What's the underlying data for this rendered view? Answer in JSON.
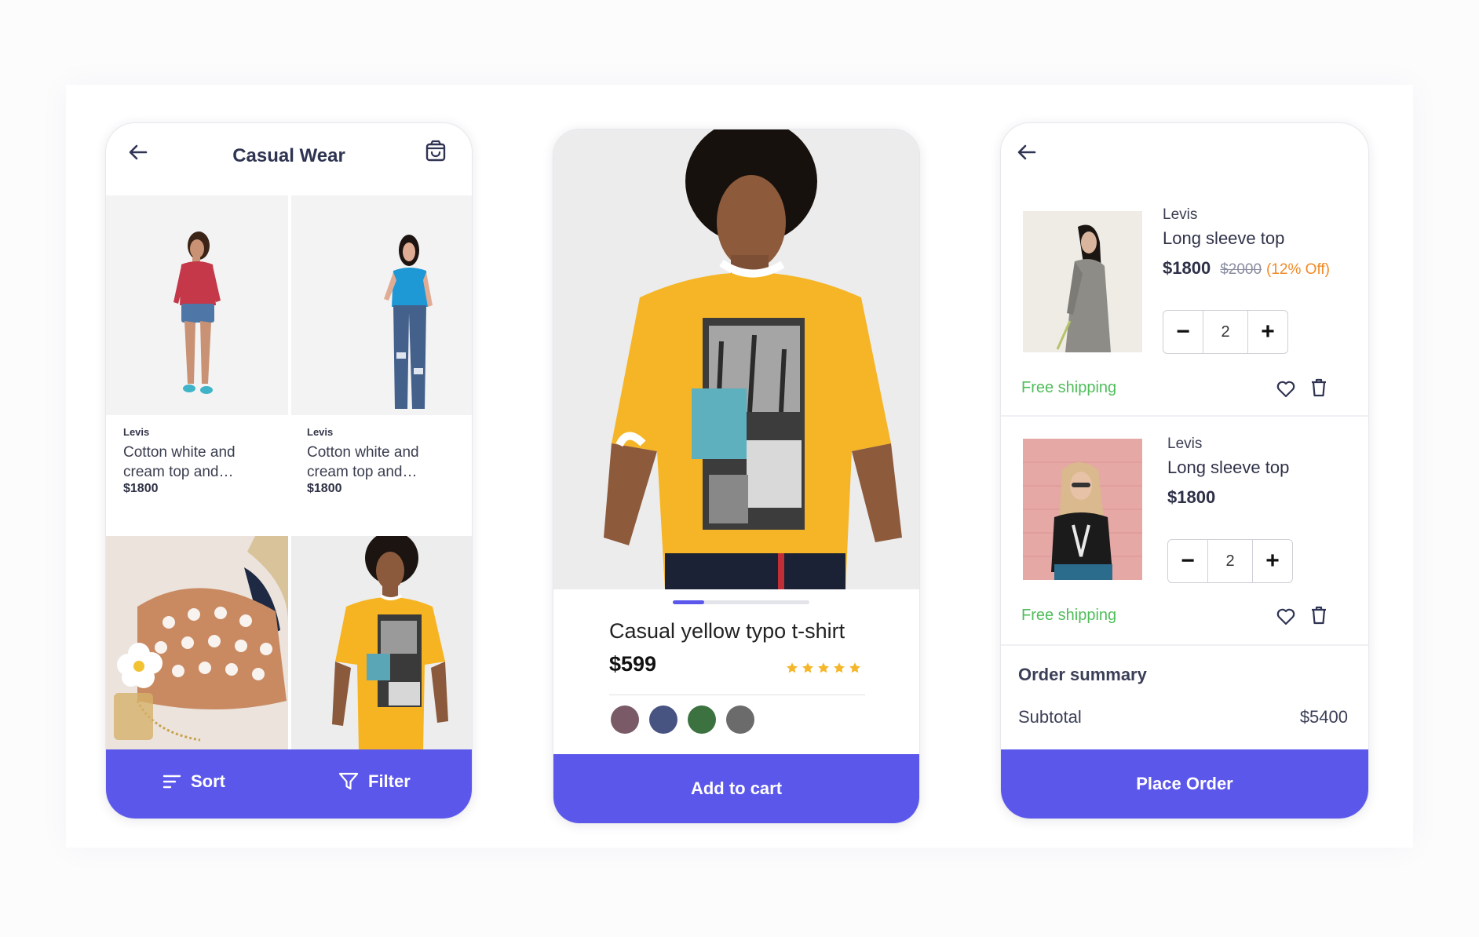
{
  "colors": {
    "accent": "#5b57eb",
    "shipping_green": "#4fbd5a",
    "discount_orange": "#f28a27",
    "star_yellow": "#f5b62a"
  },
  "list_screen": {
    "title": "Casual Wear",
    "back_icon": "arrow-left-icon",
    "cart_icon": "shopping-bag-icon",
    "products": [
      {
        "brand": "Levis",
        "name": "Cotton white and cream top and…",
        "price": "$1800"
      },
      {
        "brand": "Levis",
        "name": "Cotton white and cream top and…",
        "price": "$1800"
      }
    ],
    "sort_label": "Sort",
    "filter_label": "Filter"
  },
  "detail_screen": {
    "product_name": "Casual yellow typo t-shirt",
    "price": "$599",
    "rating": 5,
    "rating_max": 5,
    "carousel_progress": 0.23,
    "swatches": [
      "#7a5a66",
      "#475482",
      "#3c7240",
      "#6b6b6b"
    ],
    "add_to_cart_label": "Add to cart"
  },
  "cart_screen": {
    "back_icon": "arrow-left-icon",
    "items": [
      {
        "brand": "Levis",
        "name": "Long sleeve top",
        "price": "$1800",
        "old_price": "$2000",
        "discount": "(12% Off)",
        "quantity": "2",
        "shipping": "Free shipping"
      },
      {
        "brand": "Levis",
        "name": "Long sleeve top",
        "price": "$1800",
        "quantity": "2",
        "shipping": "Free shipping"
      }
    ],
    "summary_title": "Order summary",
    "subtotal_label": "Subtotal",
    "subtotal_value": "$5400",
    "place_order_label": "Place Order"
  }
}
